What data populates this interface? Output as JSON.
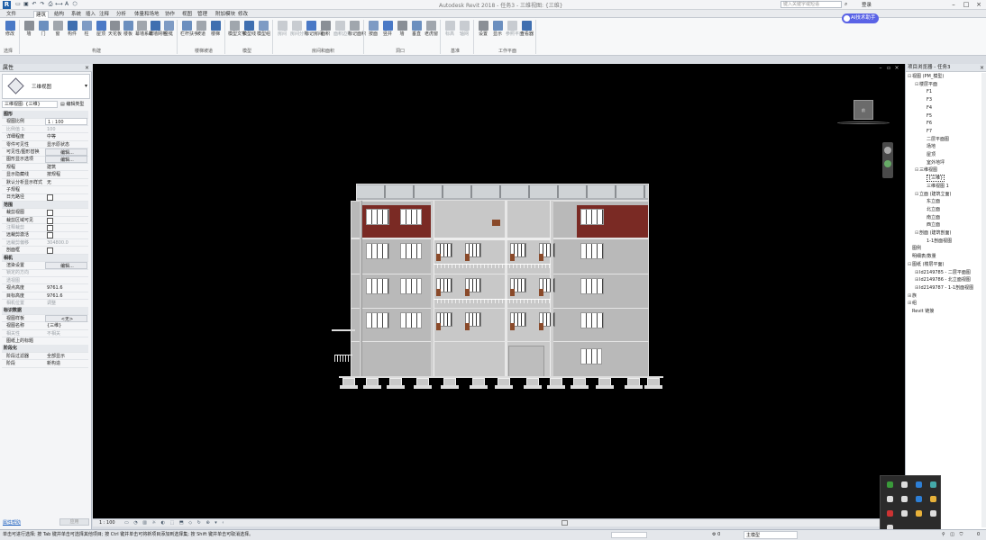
{
  "titlebar": {
    "title": "Autodesk Revit 2018 - 任务3 - 三维视图: {三维}",
    "search_placeholder": "键入关键字或短语",
    "login": "登录",
    "quick_access": [
      "open",
      "save",
      "undo",
      "redo",
      "print",
      "measure",
      "text",
      "3d"
    ]
  },
  "tabs": [
    "文件",
    "建筑",
    "结构",
    "系统",
    "插入",
    "注释",
    "分析",
    "体量和场地",
    "协作",
    "视图",
    "管理",
    "附加模块",
    "修改"
  ],
  "active_tab": "建筑",
  "ribbon": {
    "groups": [
      {
        "name": "选择",
        "items": [
          {
            "label": "修改",
            "icon": "cursor-icon"
          }
        ]
      },
      {
        "name": "构建",
        "items": [
          {
            "label": "墙",
            "icon": "wall-icon"
          },
          {
            "label": "门",
            "icon": "door-icon"
          },
          {
            "label": "窗",
            "icon": "window-icon"
          },
          {
            "label": "构件",
            "icon": "component-icon"
          },
          {
            "label": "柱",
            "icon": "column-icon"
          },
          {
            "label": "屋顶",
            "icon": "roof-icon"
          },
          {
            "label": "天花板",
            "icon": "ceiling-icon"
          },
          {
            "label": "楼板",
            "icon": "floor-icon"
          },
          {
            "label": "幕墙系统",
            "icon": "curtain-system-icon"
          },
          {
            "label": "幕墙网格",
            "icon": "curtain-grid-icon"
          },
          {
            "label": "竖梃",
            "icon": "mullion-icon"
          }
        ]
      },
      {
        "name": "楼梯坡道",
        "items": [
          {
            "label": "栏杆扶手",
            "icon": "railing-icon"
          },
          {
            "label": "坡道",
            "icon": "ramp-icon"
          },
          {
            "label": "楼梯",
            "icon": "stair-icon"
          }
        ]
      },
      {
        "name": "模型",
        "items": [
          {
            "label": "模型文字",
            "icon": "model-text-icon"
          },
          {
            "label": "模型线",
            "icon": "model-line-icon"
          },
          {
            "label": "模型组",
            "icon": "model-group-icon"
          }
        ]
      },
      {
        "name": "房间和面积",
        "items": [
          {
            "label": "房间",
            "icon": "room-icon",
            "dim": true
          },
          {
            "label": "房间分隔",
            "icon": "room-separator-icon",
            "dim": true
          },
          {
            "label": "标记房间",
            "icon": "tag-room-icon"
          },
          {
            "label": "面积",
            "icon": "area-icon"
          },
          {
            "label": "面积边界",
            "icon": "area-boundary-icon",
            "dim": true
          },
          {
            "label": "标记面积",
            "icon": "tag-area-icon"
          }
        ]
      },
      {
        "name": "洞口",
        "items": [
          {
            "label": "按面",
            "icon": "by-face-icon"
          },
          {
            "label": "竖井",
            "icon": "shaft-icon"
          },
          {
            "label": "墙",
            "icon": "wall-opening-icon"
          },
          {
            "label": "垂直",
            "icon": "vertical-icon"
          },
          {
            "label": "老虎窗",
            "icon": "dormer-icon"
          }
        ]
      },
      {
        "name": "基准",
        "items": [
          {
            "label": "标高",
            "icon": "level-icon",
            "dim": true
          },
          {
            "label": "轴网",
            "icon": "grid-icon",
            "dim": true
          }
        ]
      },
      {
        "name": "工作平面",
        "items": [
          {
            "label": "设置",
            "icon": "set-icon"
          },
          {
            "label": "显示",
            "icon": "show-icon"
          },
          {
            "label": "参照平面",
            "icon": "ref-plane-icon",
            "dim": true
          },
          {
            "label": "查看器",
            "icon": "viewer-icon"
          }
        ]
      }
    ],
    "ai_button": "AI技术助手"
  },
  "properties": {
    "title": "属性",
    "type_name": "三维视图",
    "view_selector": "三维视图: {三维}",
    "edit_type": "编辑类型",
    "rows": [
      {
        "cat": true,
        "k": "图形"
      },
      {
        "k": "视图比例",
        "v": "1 : 100",
        "input": true
      },
      {
        "k": "比例值 1:",
        "v": "100",
        "gray": true
      },
      {
        "k": "详细程度",
        "v": "中等"
      },
      {
        "k": "零件可见性",
        "v": "显示原状态"
      },
      {
        "k": "可见性/图形替换",
        "v": "编辑...",
        "btn": true
      },
      {
        "k": "图形显示选项",
        "v": "编辑...",
        "btn": true
      },
      {
        "k": "规程",
        "v": "建筑"
      },
      {
        "k": "显示隐藏线",
        "v": "按规程"
      },
      {
        "k": "默认分析显示样式",
        "v": "无"
      },
      {
        "k": "子规程",
        "v": ""
      },
      {
        "k": "日光路径",
        "v": "",
        "chk": true
      },
      {
        "cat": true,
        "k": "范围"
      },
      {
        "k": "裁剪视图",
        "v": "",
        "chk": true
      },
      {
        "k": "裁剪区域可见",
        "v": "",
        "chk": true
      },
      {
        "k": "注释裁剪",
        "v": "",
        "chk": true,
        "gray": true
      },
      {
        "k": "远裁剪激活",
        "v": "",
        "chk": true
      },
      {
        "k": "远裁剪偏移",
        "v": "304800.0",
        "gray": true
      },
      {
        "k": "剖面框",
        "v": "",
        "chk": true
      },
      {
        "cat": true,
        "k": "相机"
      },
      {
        "k": "渲染设置",
        "v": "编辑...",
        "btn": true
      },
      {
        "k": "锁定的方向",
        "v": "",
        "gray": true
      },
      {
        "k": "透视图",
        "v": "",
        "gray": true
      },
      {
        "k": "视点高度",
        "v": "9761.6"
      },
      {
        "k": "目标高度",
        "v": "9761.6"
      },
      {
        "k": "相机位置",
        "v": "调整",
        "gray": true
      },
      {
        "cat": true,
        "k": "标识数据"
      },
      {
        "k": "视图样板",
        "v": "<无>",
        "btn": true
      },
      {
        "k": "视图名称",
        "v": "{三维}"
      },
      {
        "k": "相关性",
        "v": "不相关",
        "gray": true
      },
      {
        "k": "图纸上的标题",
        "v": ""
      },
      {
        "cat": true,
        "k": "阶段化"
      },
      {
        "k": "阶段过滤器",
        "v": "全部显示"
      },
      {
        "k": "阶段",
        "v": "新构造"
      }
    ],
    "help_link": "属性帮助",
    "apply": "应用"
  },
  "viewport": {
    "viewcube_label": "前",
    "view_scale": "1 : 100",
    "background": "#000000"
  },
  "status": {
    "message": "单击可进行选择; 按 Tab 键并单击可选择其他项目; 按 Ctrl 键并单击可将新项目添加到选择集; 按 Shift 键并单击可取消选择。",
    "selection": "主模型",
    "filter_count": "0"
  },
  "browser": {
    "title": "项目浏览器 - 任务3",
    "nodes": [
      {
        "t": "视图 (PM_模型)",
        "lvl": 0,
        "tg": "⊟"
      },
      {
        "t": "楼层平面",
        "lvl": 1,
        "tg": "⊟"
      },
      {
        "t": "F1",
        "lvl": 2
      },
      {
        "t": "F3",
        "lvl": 2
      },
      {
        "t": "F4",
        "lvl": 2
      },
      {
        "t": "F5",
        "lvl": 2
      },
      {
        "t": "F6",
        "lvl": 2
      },
      {
        "t": "F7",
        "lvl": 2
      },
      {
        "t": "二层平面图",
        "lvl": 2
      },
      {
        "t": "场地",
        "lvl": 2
      },
      {
        "t": "屋顶",
        "lvl": 2
      },
      {
        "t": "室外地坪",
        "lvl": 2
      },
      {
        "t": "三维视图",
        "lvl": 1,
        "tg": "⊟"
      },
      {
        "t": "{三维}",
        "lvl": 2,
        "sel": true
      },
      {
        "t": "三维视图 1",
        "lvl": 2
      },
      {
        "t": "立面 (建筑立面)",
        "lvl": 1,
        "tg": "⊟"
      },
      {
        "t": "东立面",
        "lvl": 2
      },
      {
        "t": "北立面",
        "lvl": 2
      },
      {
        "t": "南立面",
        "lvl": 2
      },
      {
        "t": "西立面",
        "lvl": 2
      },
      {
        "t": "剖面 (建筑剖面)",
        "lvl": 1,
        "tg": "⊟"
      },
      {
        "t": "1-1剖面视图",
        "lvl": 2
      },
      {
        "t": "图例",
        "lvl": 0
      },
      {
        "t": "明细表/数量",
        "lvl": 0
      },
      {
        "t": "图纸 (楼层平面)",
        "lvl": 0,
        "tg": "⊟"
      },
      {
        "t": "Id2149785 - 二层平面图",
        "lvl": 1,
        "tg": "⊞"
      },
      {
        "t": "Id2149786 - 北立面视图",
        "lvl": 1,
        "tg": "⊞"
      },
      {
        "t": "Id2149787 - 1-1剖面视图",
        "lvl": 1,
        "tg": "⊞"
      },
      {
        "t": "族",
        "lvl": 0,
        "tg": "⊞"
      },
      {
        "t": "组",
        "lvl": 0,
        "tg": "⊞"
      },
      {
        "t": "Revit 链接",
        "lvl": 0
      }
    ]
  },
  "colors": {
    "accent": "#1f5fa8",
    "brick": "#7a2a24",
    "facade": "#b9b9b9",
    "ai": "#5a63e6"
  }
}
